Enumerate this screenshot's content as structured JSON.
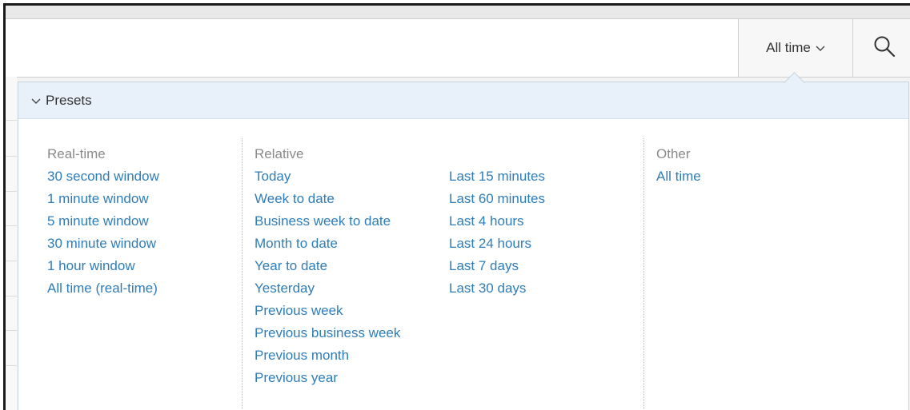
{
  "time_picker": {
    "label": "All time"
  },
  "search": {
    "value": "",
    "placeholder": ""
  },
  "presets": {
    "header": "Presets",
    "real_time": {
      "title": "Real-time",
      "items": [
        "30 second window",
        "1 minute window",
        "5 minute window",
        "30 minute window",
        "1 hour window",
        "All time (real-time)"
      ]
    },
    "relative": {
      "title": "Relative",
      "items_left": [
        "Today",
        "Week to date",
        "Business week to date",
        "Month to date",
        "Year to date",
        "Yesterday",
        "Previous week",
        "Previous business week",
        "Previous month",
        "Previous year"
      ],
      "items_right": [
        "Last 15 minutes",
        "Last 60 minutes",
        "Last 4 hours",
        "Last 24 hours",
        "Last 7 days",
        "Last 30 days"
      ]
    },
    "other": {
      "title": "Other",
      "items": [
        "All time"
      ]
    }
  },
  "icons": {
    "search": "search-icon",
    "chevron": "chevron-down-icon"
  },
  "colors": {
    "link": "#2f7db8",
    "header_bg": "#e8f1fa",
    "muted": "#8a8a8a"
  }
}
